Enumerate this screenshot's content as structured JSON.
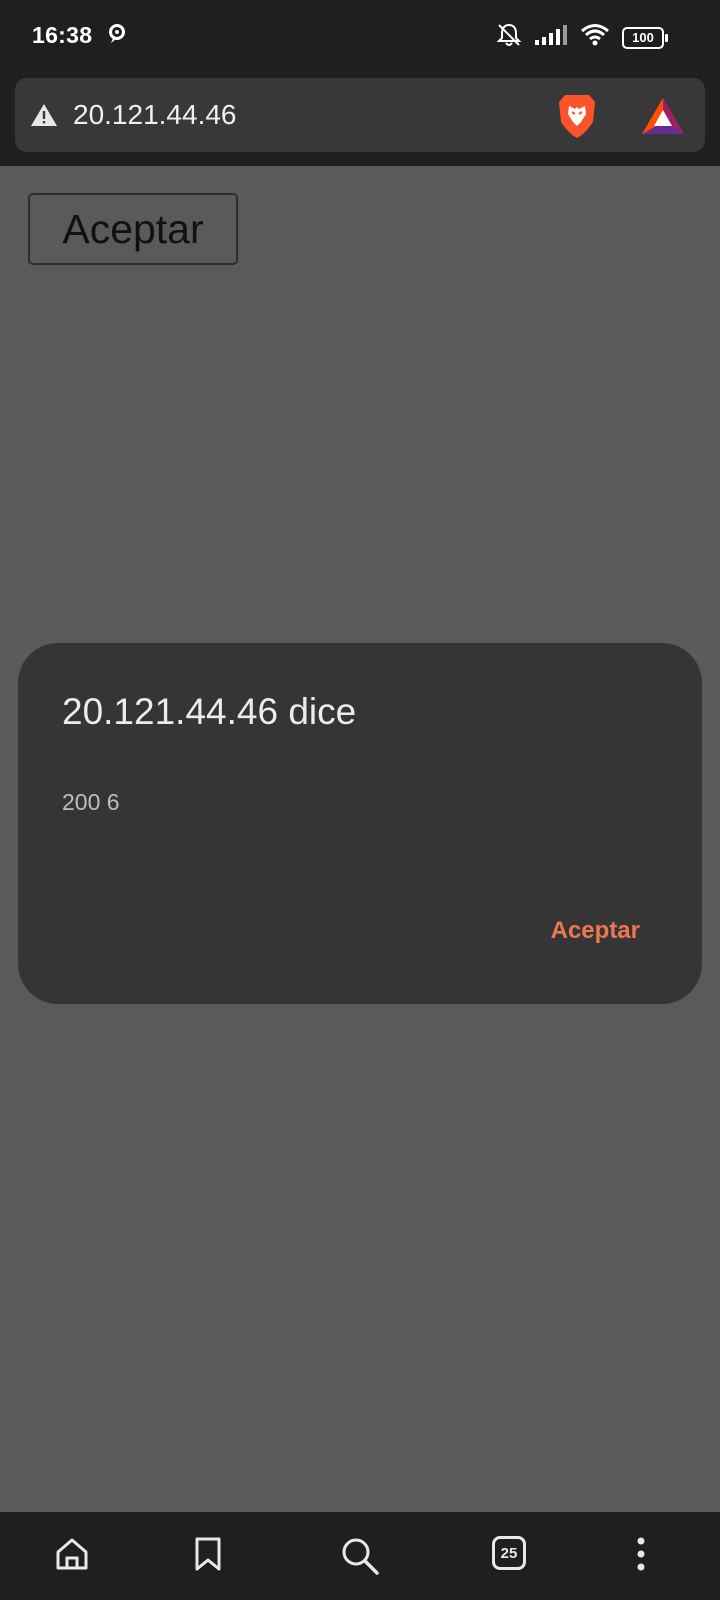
{
  "status": {
    "time": "16:38",
    "battery": "100",
    "icons": [
      "notification-icon",
      "mute-icon",
      "signal-icon",
      "wifi-icon",
      "battery-icon"
    ]
  },
  "browser": {
    "url": "20.121.44.46",
    "icons": [
      "warning-icon",
      "brave-shields-icon",
      "bat-rewards-icon"
    ]
  },
  "page": {
    "button_label": "Aceptar"
  },
  "dialog": {
    "title": "20.121.44.46 dice",
    "message": "200 6",
    "ok_label": "Aceptar",
    "accent_color": "#ee7650"
  },
  "bottom_nav": {
    "tab_count": "25",
    "icons": [
      "home-icon",
      "bookmark-icon",
      "search-icon",
      "tabs-icon",
      "more-icon"
    ]
  }
}
